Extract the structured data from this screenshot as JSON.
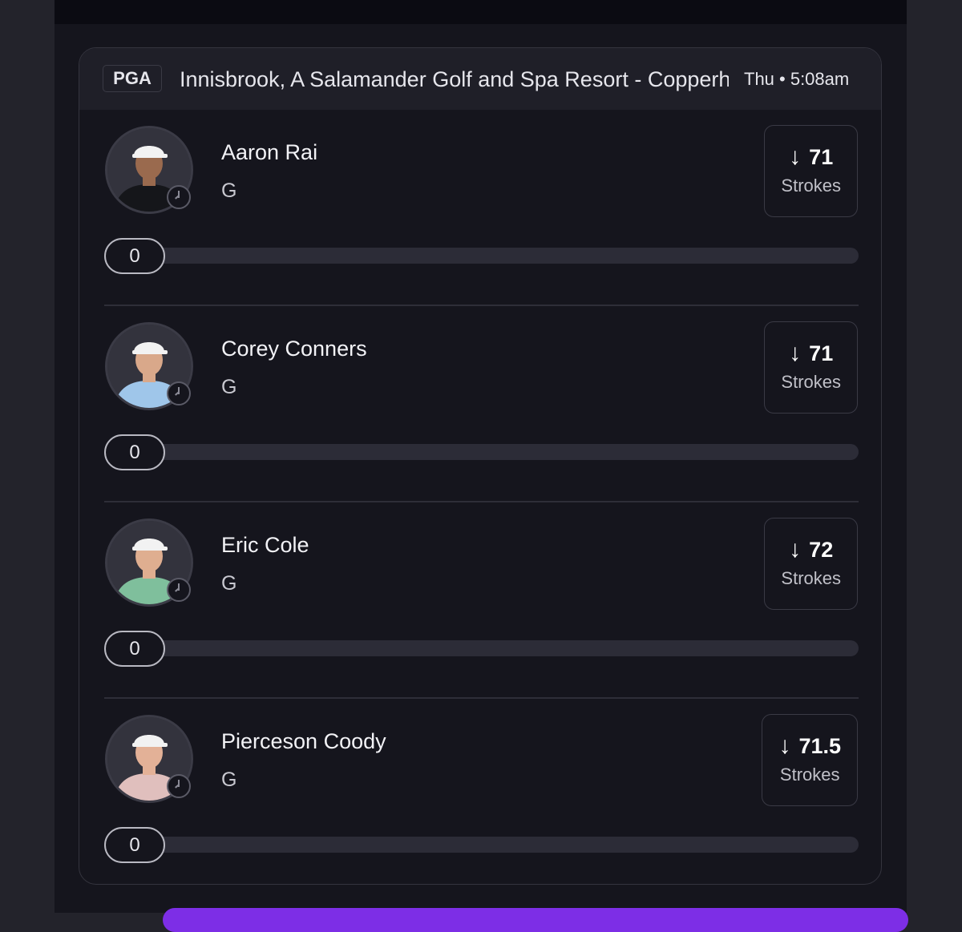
{
  "header": {
    "league": "PGA",
    "event": "Innisbrook, A Salamander Golf and Spa Resort - Copperhead Course",
    "time": "Thu • 5:08am"
  },
  "players": [
    {
      "name": "Aaron Rai",
      "position": "G",
      "line": "71",
      "stat": "Strokes",
      "direction": "↓",
      "pick_count": "0",
      "colors": {
        "shirt": "#15161a",
        "cap": "#f2f2f2",
        "skin": "#9a6a4e",
        "bg": "#33333d"
      }
    },
    {
      "name": "Corey Conners",
      "position": "G",
      "line": "71",
      "stat": "Strokes",
      "direction": "↓",
      "pick_count": "0",
      "colors": {
        "shirt": "#9fc6ea",
        "cap": "#f2f2f2",
        "skin": "#d9a88a",
        "bg": "#33333d"
      }
    },
    {
      "name": "Eric Cole",
      "position": "G",
      "line": "72",
      "stat": "Strokes",
      "direction": "↓",
      "pick_count": "0",
      "colors": {
        "shirt": "#7fbf9c",
        "cap": "#f2f2f2",
        "skin": "#dfae90",
        "bg": "#33333d"
      }
    },
    {
      "name": "Pierceson Coody",
      "position": "G",
      "line": "71.5",
      "stat": "Strokes",
      "direction": "↓",
      "pick_count": "0",
      "colors": {
        "shirt": "#e0bfbd",
        "cap": "#f2f2f2",
        "skin": "#e3b197",
        "bg": "#33333d"
      }
    }
  ],
  "colors": {
    "background": "#15151d",
    "accent_button": "#7d2ee6"
  }
}
